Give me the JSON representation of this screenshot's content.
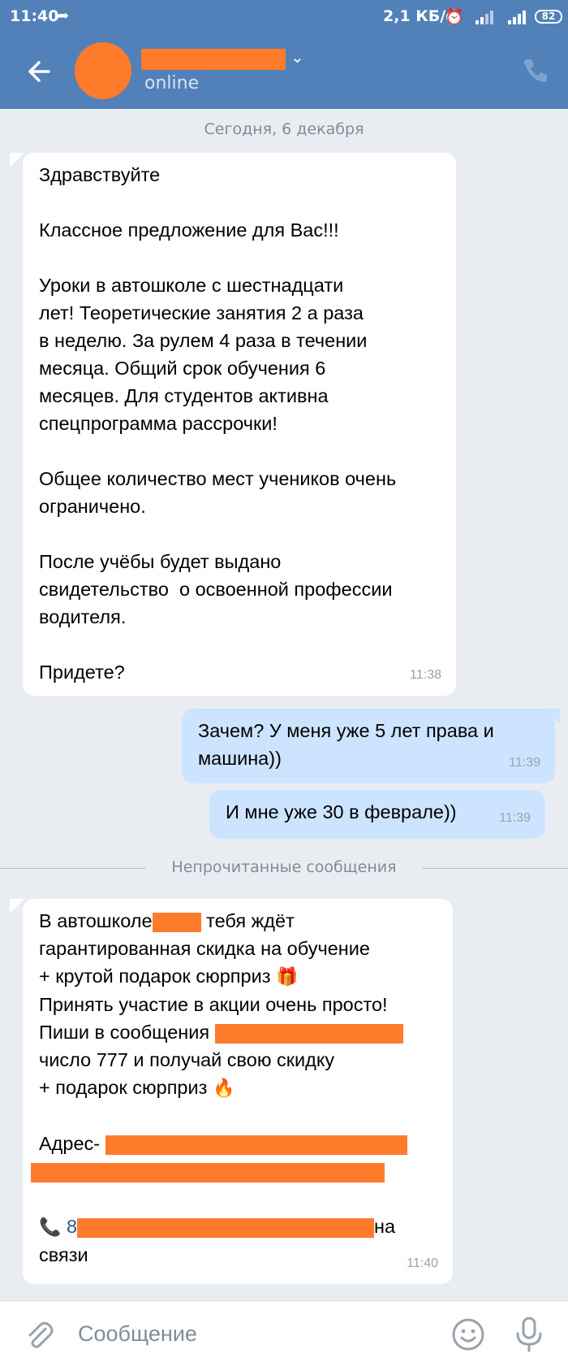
{
  "status_bar": {
    "time": "11:40",
    "net_speed": "2,1 КБ/с",
    "battery": "82",
    "network_type": "4G"
  },
  "header": {
    "status": "online"
  },
  "date_separator": "Сегодня, 6 декабря",
  "unread_separator": "Непрочитанные сообщения",
  "messages": [
    {
      "dir": "in",
      "text": "Здравствуйте\n\nКлассное предложение для Вас!!!\n\nУроки в автошколе с шестнадцати\nлет! Теоретические занятия 2 а раза\nв неделю. За рулем 4 раза в течении\nмесяца. Общий срок обучения 6\nмесяцев. Для студентов активна\nспецпрограмма рассрочки!\n\nОбщее количество мест учеников очень\nограничено.\n\nПосле учёбы будет выдано\nсвидетельство  о освоенной профессии\nводителя.\n\nПридете?",
      "time": "11:38"
    },
    {
      "dir": "out",
      "text": "Зачем? У меня уже 5 лет права и\nмашина))",
      "time": "11:39"
    },
    {
      "dir": "out",
      "text": "И мне уже 30 в феврале))",
      "time": "11:39"
    },
    {
      "dir": "in",
      "time": "11:40",
      "lines": {
        "l1a": "В автошколе",
        "l1b": " тебя ждёт",
        "l2": "гарантированная скидка на обучение",
        "l3": "+ крутой подарок сюрприз",
        "l3_emoji": "🎁",
        "l4": "Принять участие в акции очень просто!",
        "l5": "Пиши в сообщения",
        "l6": "число 777 и получай свою скидку",
        "l7": "+ подарок сюрприз",
        "l7_emoji": "🔥",
        "l8": "Адрес-",
        "l9_icon": "📞",
        "l9a": "8",
        "l9b": "на",
        "l10": "связи"
      }
    }
  ],
  "composer": {
    "placeholder": "Сообщение"
  }
}
